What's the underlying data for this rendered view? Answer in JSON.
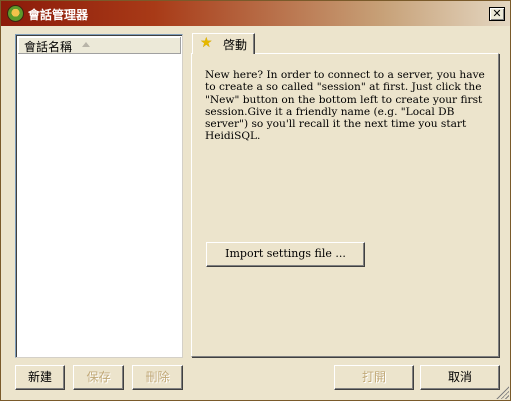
{
  "window": {
    "title": "會話管理器",
    "close_label": "✕"
  },
  "session_list": {
    "column_header": "會話名稱",
    "sort_icon": "sort-ascending-icon",
    "items": []
  },
  "tabs": [
    {
      "label": "啓動",
      "icon": "star-icon",
      "active": true
    }
  ],
  "start_tab": {
    "intro_text": "New here? In order to connect to a server, you have to create a so called \"session\" at first. Just click the \"New\" button on the bottom left to create your first session.Give it a friendly name (e.g. \"Local DB server\") so you'll recall it the next time you start HeidiSQL.",
    "import_button": "Import settings file ..."
  },
  "buttons": {
    "new": {
      "label": "新建",
      "enabled": true
    },
    "save": {
      "label": "保存",
      "enabled": false
    },
    "delete": {
      "label": "刪除",
      "enabled": false
    },
    "open": {
      "label": "打開",
      "enabled": false
    },
    "cancel": {
      "label": "取消",
      "enabled": true
    }
  },
  "colors": {
    "titlebar_start": "#8b1a0a",
    "titlebar_end": "#e4d7c2",
    "face": "#ECE4CC",
    "disabled_text": "#c1a978"
  }
}
